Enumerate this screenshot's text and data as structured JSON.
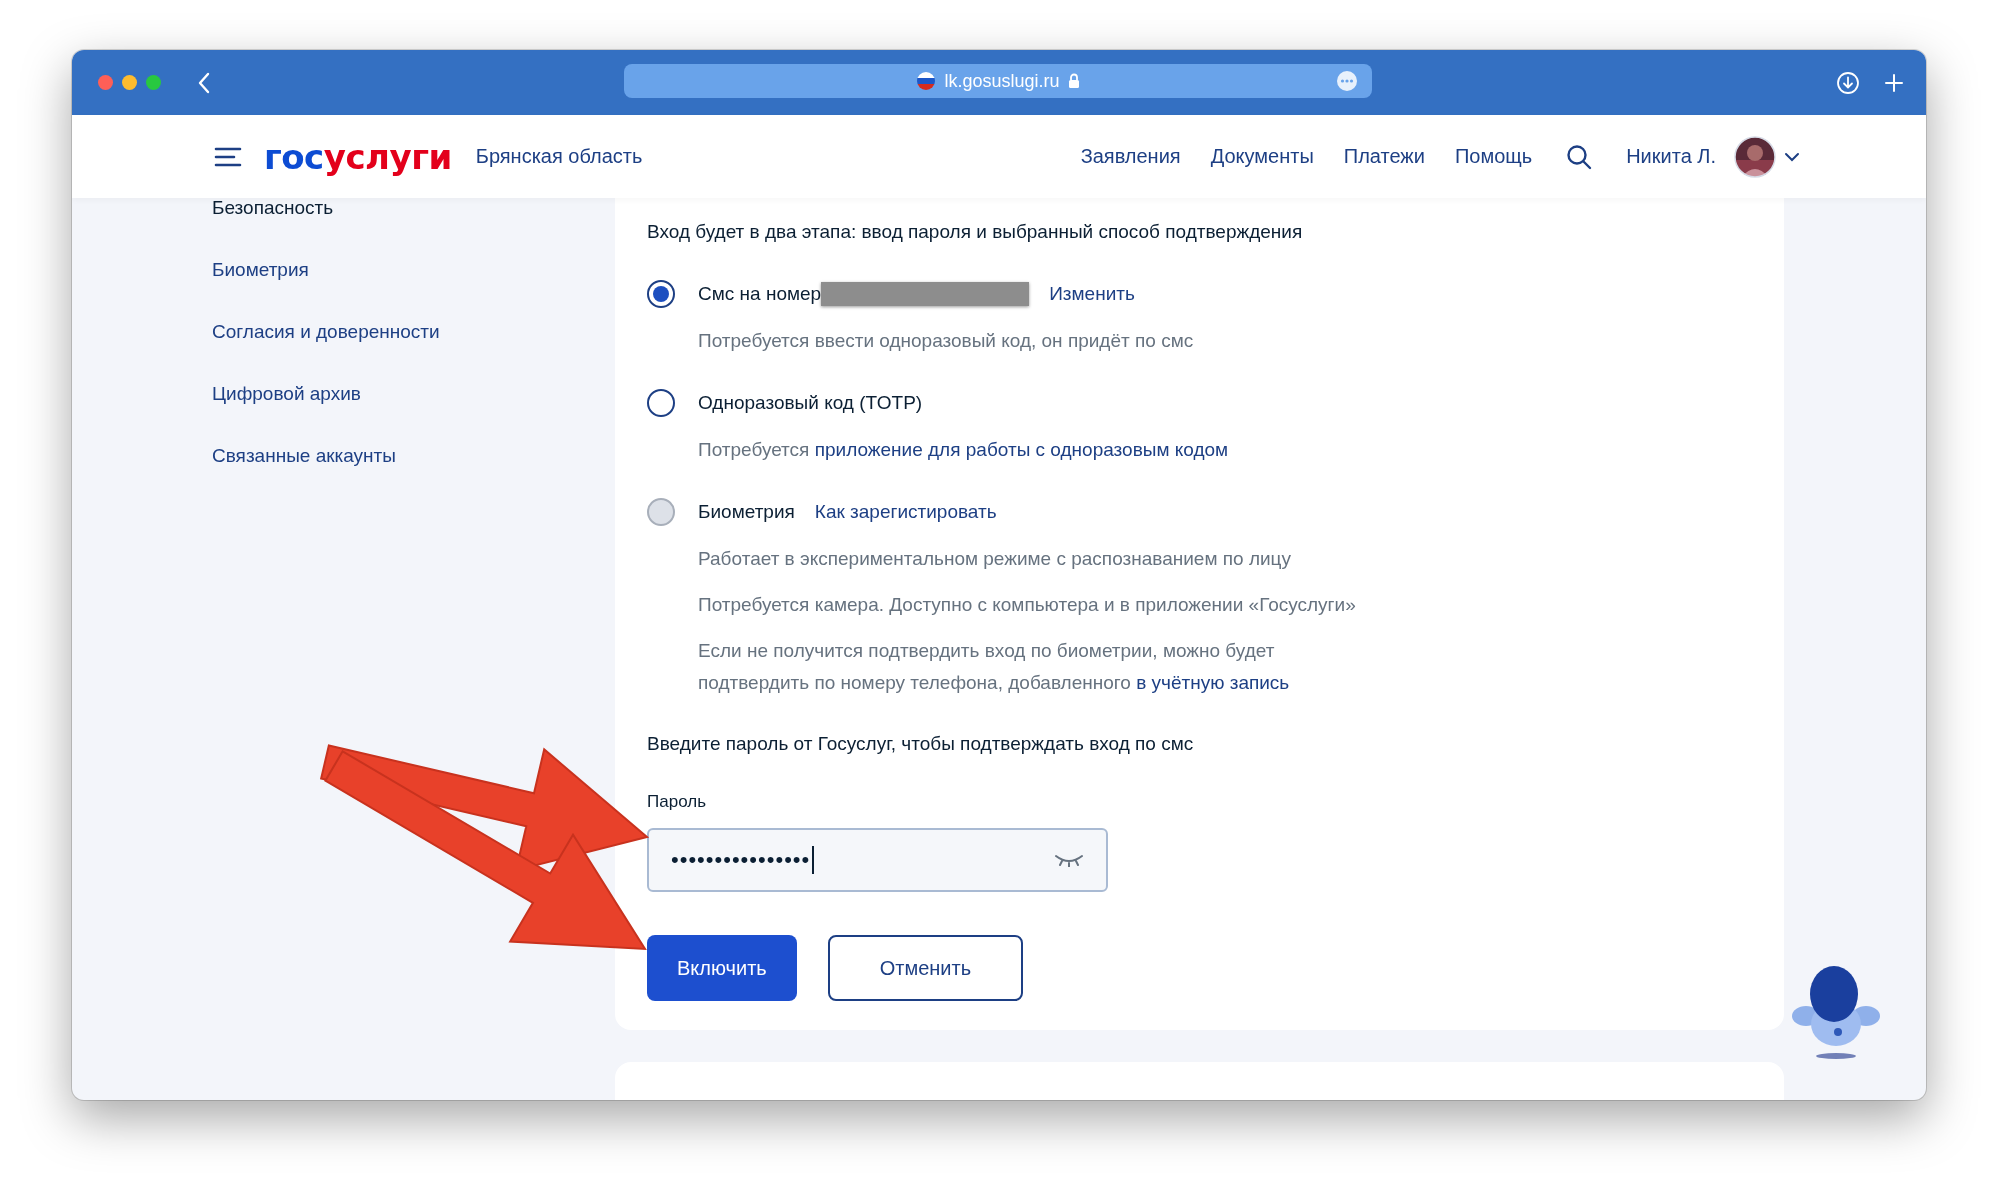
{
  "browser": {
    "url": "lk.gosuslugi.ru"
  },
  "header": {
    "logo": [
      "гос",
      "услуги"
    ],
    "region": "Брянская область",
    "nav": [
      "Заявления",
      "Документы",
      "Платежи",
      "Помощь"
    ],
    "user": "Никита Л."
  },
  "sidebar": {
    "items": [
      {
        "label": "Безопасность",
        "selected": true
      },
      {
        "label": "Биометрия",
        "selected": false
      },
      {
        "label": "Согласия и доверенности",
        "selected": false
      },
      {
        "label": "Цифровой архив",
        "selected": false
      },
      {
        "label": "Связанные аккаунты",
        "selected": false
      }
    ]
  },
  "card": {
    "intro": "Вход будет в два этапа: ввод пароля и выбранный способ подтверждения",
    "options": [
      {
        "label": "Смс на номер",
        "phone_hidden": true,
        "link": "Изменить",
        "selected": true,
        "disabled": false,
        "notes": [
          {
            "text": "Потребуется ввести одноразовый код, он придёт по смс"
          }
        ]
      },
      {
        "label": "Одноразовый код (TOTP)",
        "selected": false,
        "disabled": false,
        "notes": [
          {
            "text": "Потребуется ",
            "link": "приложение для работы с одноразовым кодом"
          }
        ]
      },
      {
        "label": "Биометрия",
        "link": "Как зарегистировать",
        "selected": false,
        "disabled": true,
        "notes": [
          {
            "text": "Работает в экспериментальном режиме с распознаванием по лицу"
          },
          {
            "text": "Потребуется камера. Доступно с компьютера и в приложении «Госуслуги»"
          },
          {
            "text": "Если не получится подтвердить вход по биометрии, можно будет подтвердить по номеру телефона, добавленного ",
            "link": "в учётную запись"
          }
        ]
      }
    ],
    "password": {
      "prompt": "Введите пароль от Госуслуг, чтобы подтверждать вход по смс",
      "label": "Пароль",
      "value": "••••••••••••••••",
      "masked": true,
      "focused": true
    },
    "buttons": [
      {
        "label": "Включить",
        "kind": "primary"
      },
      {
        "label": "Отменить",
        "kind": "secondary"
      }
    ]
  }
}
